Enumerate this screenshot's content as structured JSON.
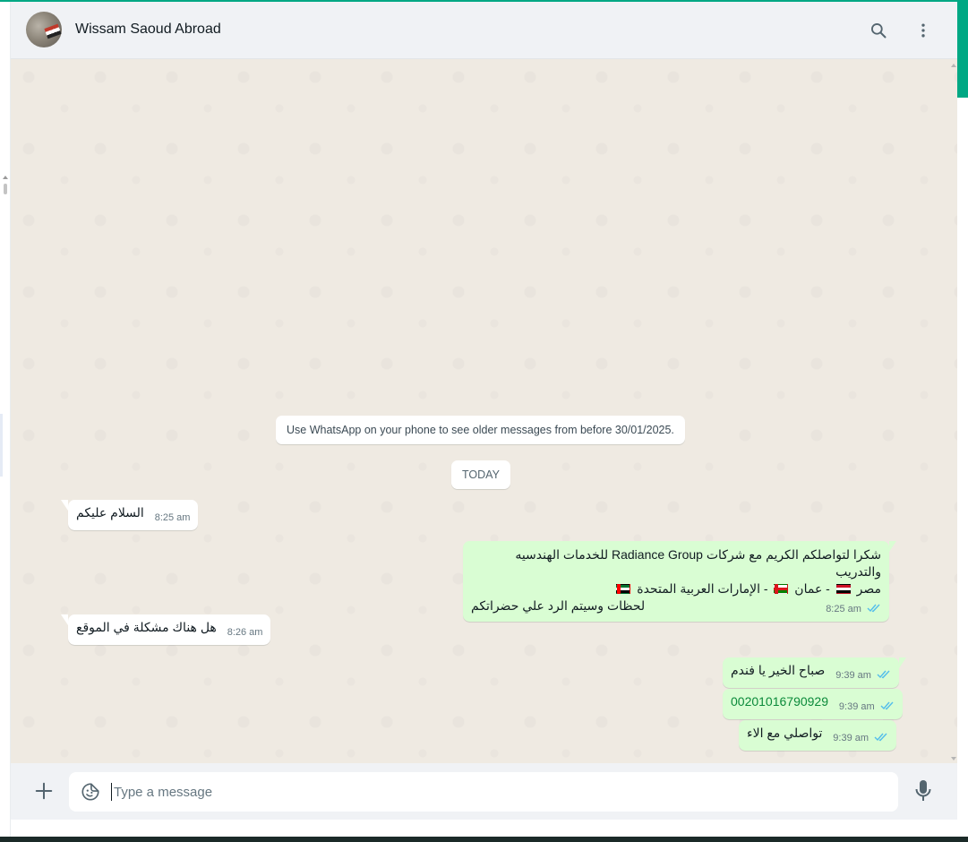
{
  "header": {
    "contact_name": "Wissam Saoud Abroad",
    "search_icon": "search-icon",
    "menu_icon": "kebab-menu-icon"
  },
  "messages": {
    "system_note": "Use WhatsApp on your phone to see older messages from before 30/01/2025.",
    "date_divider": "TODAY",
    "items": [
      {
        "direction": "in",
        "text": "السلام عليكم",
        "time": "8:25 am"
      },
      {
        "direction": "out",
        "line1": "شكرا لتواصلكم الكريم مع شركات Radiance Group للخدمات الهندسيه والتدريب",
        "line2_a": "مصر",
        "line2_b": "- عمان",
        "line2_c": "- الإمارات العربية المتحدة",
        "line3": "لحظات وسيتم الرد علي حضراتكم",
        "time": "8:25 am",
        "status": "read"
      },
      {
        "direction": "in",
        "text": "هل هناك مشكلة في الموقع",
        "time": "8:26 am"
      },
      {
        "direction": "out",
        "text": "صباح الخير يا فندم",
        "time": "9:39 am",
        "status": "read"
      },
      {
        "direction": "out",
        "text": "00201016790929",
        "time": "9:39 am",
        "status": "read"
      },
      {
        "direction": "out",
        "text": "تواصلي مع الاء",
        "time": "9:39 am",
        "status": "read"
      }
    ]
  },
  "composer": {
    "placeholder": "Type a message",
    "add_icon": "plus-icon",
    "sticker_icon": "sticker-icon",
    "mic_icon": "microphone-icon"
  },
  "colors": {
    "accent": "#00a884",
    "outgoing_bubble": "#d9fdd3",
    "incoming_bubble": "#ffffff",
    "chat_background": "#efeae2",
    "read_ticks": "#53bdeb"
  }
}
